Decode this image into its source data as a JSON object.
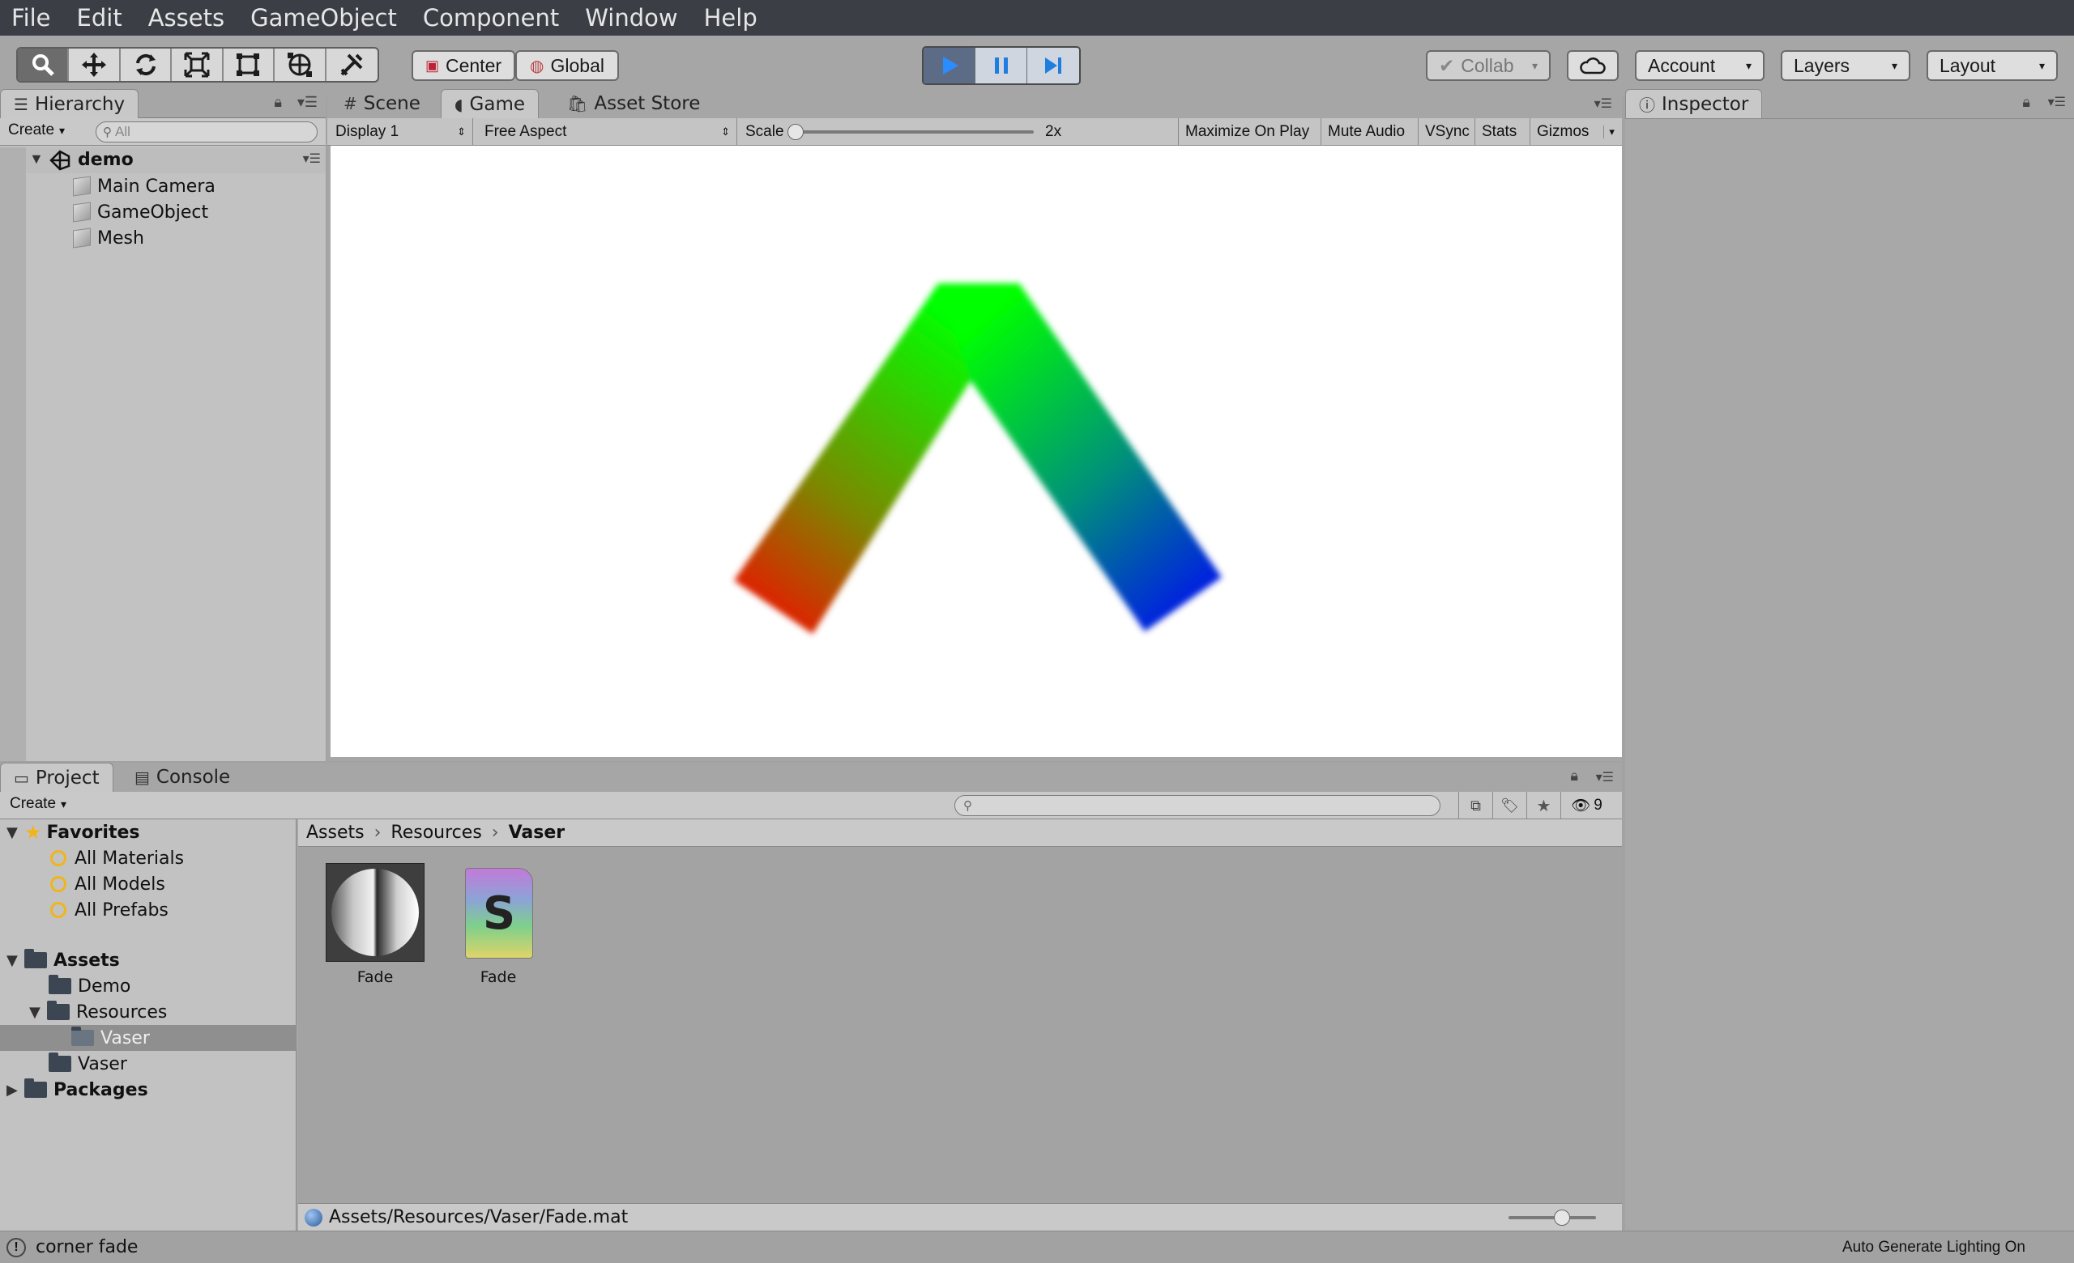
{
  "menubar": {
    "items": [
      "File",
      "Edit",
      "Assets",
      "GameObject",
      "Component",
      "Window",
      "Help"
    ]
  },
  "toolbar": {
    "tools": [
      "search-tool-icon",
      "move-tool-icon",
      "rotate-tool-icon",
      "scale-tool-icon",
      "rect-tool-icon",
      "transform-tool-icon",
      "custom-tool-icon"
    ],
    "pivot_center": "Center",
    "pivot_global": "Global",
    "collab": "Collab",
    "account": "Account",
    "layers": "Layers",
    "layout": "Layout"
  },
  "hierarchy": {
    "tab": "Hierarchy",
    "create": "Create",
    "search_placeholder": "All",
    "scene": "demo",
    "items": [
      "Main Camera",
      "GameObject",
      "Mesh"
    ]
  },
  "center_tabs": {
    "scene": "Scene",
    "game": "Game",
    "asset_store": "Asset Store"
  },
  "game_bar": {
    "display": "Display 1",
    "aspect": "Free Aspect",
    "scale_label": "Scale",
    "scale_value": "2x",
    "maximize": "Maximize On Play",
    "mute": "Mute Audio",
    "vsync": "VSync",
    "stats": "Stats",
    "gizmos": "Gizmos"
  },
  "inspector": {
    "tab": "Inspector"
  },
  "project": {
    "tab": "Project",
    "console_tab": "Console",
    "create": "Create",
    "hidden_count": "9",
    "favorites": {
      "label": "Favorites",
      "items": [
        "All Materials",
        "All Models",
        "All Prefabs"
      ]
    },
    "assets": {
      "label": "Assets",
      "items": [
        "Demo",
        "Resources",
        "Vaser",
        "Vaser"
      ]
    },
    "packages": "Packages",
    "breadcrumb": [
      "Assets",
      "Resources",
      "Vaser"
    ],
    "files": [
      {
        "name": "Fade",
        "kind": "material"
      },
      {
        "name": "Fade",
        "kind": "shader"
      }
    ],
    "path": "Assets/Resources/Vaser/Fade.mat"
  },
  "status": {
    "left": "corner fade",
    "right": "Auto Generate Lighting On"
  },
  "colors": {
    "menubar": "#3b3e45",
    "accent_play": "#2b8cff",
    "selection": "#8f8f8f"
  }
}
